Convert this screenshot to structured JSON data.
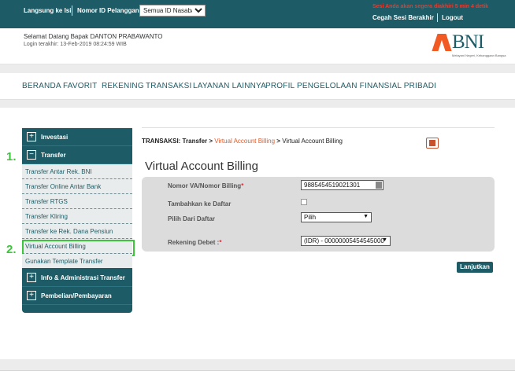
{
  "topbar": {
    "quick_link": "Langsung ke Isi",
    "id_label": "Nomor ID Pelanggan:",
    "id_select": "Semua ID Nasabah",
    "warning": "Sesi Anda akan segera diakhiri 5 min 4 detik",
    "end_session": "Cegah Sesi Berakhir",
    "logout": "Logout"
  },
  "welcome": {
    "greeting": "Selamat Datang Bapak  DANTON  PRABAWANTO",
    "last_login": "Login terakhir:  13-Feb-2019 08:24:59  WIB"
  },
  "logo": {
    "name": "BNI",
    "tagline": "Melayani Negeri, Kebanggaan Bangsa",
    "brand_color": "#f15a22",
    "primary_color": "#1d5c66"
  },
  "nav": [
    "BERANDA",
    "FAVORIT",
    "REKENING",
    "TRANSAKSI",
    "LAYANAN LAINNYA",
    "PROFIL",
    "PENGELOLAAN FINANSIAL PRIBADI"
  ],
  "sidebar": {
    "investasi": "Investasi",
    "transfer": "Transfer",
    "items": [
      "Transfer Antar Rek. BNI",
      "Transfer Online Antar Bank",
      "Transfer RTGS",
      "Transfer Kliring",
      "Transfer ke Rek. Dana Pensiun",
      "Virtual Account Billing",
      "Gunakan Template Transfer"
    ],
    "info_admin": "Info & Administrasi Transfer",
    "pembelian": "Pembelian/Pembayaran"
  },
  "steps": {
    "one": "1.",
    "two": "2."
  },
  "breadcrumb": {
    "prefix": "TRANSAKSI: Transfer >",
    "link": "Virtual Account Billing",
    "sep": ">",
    "current": "Virtual Account Billing"
  },
  "page_title": "Virtual Account Billing",
  "form": {
    "va_label": "Nomor VA/Nomor Billing",
    "required_mark": "*",
    "va_value": "9885454519021301",
    "add_label": "Tambahkan ke Daftar",
    "list_label": "Pilih Dari Daftar",
    "list_value": "Pilih",
    "debit_label": "Rekening Debet :",
    "debit_value": "(IDR) - 00000005454545000",
    "caret": "▼"
  },
  "continue_button": "Lanjutkan"
}
